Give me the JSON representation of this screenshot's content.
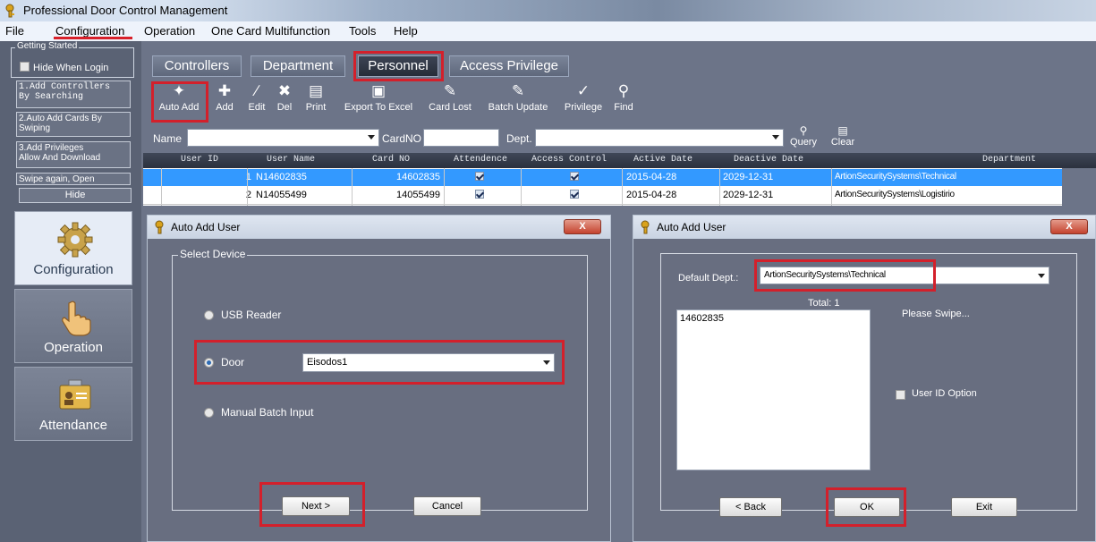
{
  "window": {
    "title": "Professional Door Control Management"
  },
  "menu": [
    "File",
    "Configuration",
    "Operation",
    "One Card Multifunction",
    "Tools",
    "Help"
  ],
  "sidebar": {
    "getting_started": "Getting Started",
    "hide_when_login": "Hide When Login",
    "steps": [
      "1.Add Controllers\nBy Searching",
      "2.Auto Add Cards By\nSwiping",
      "3.Add Privileges\nAllow And Download",
      "Swipe again, Open"
    ],
    "hide_button": "Hide",
    "nav": [
      "Configuration",
      "Operation",
      "Attendance"
    ]
  },
  "tabs": [
    "Controllers",
    "Department",
    "Personnel",
    "Access Privilege"
  ],
  "toolbar": [
    "Auto Add",
    "Add",
    "Edit",
    "Del",
    "Print",
    "Export To Excel",
    "Card Lost",
    "Batch Update",
    "Privilege",
    "Find"
  ],
  "search": {
    "name_label": "Name",
    "cardno_label": "CardNO",
    "dept_label": "Dept.",
    "query": "Query",
    "clear": "Clear"
  },
  "grid": {
    "columns": [
      "User ID",
      "User Name",
      "Card NO",
      "Attendence",
      "Access Control",
      "Active Date",
      "Deactive Date",
      "Department"
    ],
    "rows": [
      {
        "id": "1",
        "name": "N14602835",
        "card": "14602835",
        "attendance": true,
        "access": true,
        "active": "2015-04-28",
        "deactive": "2029-12-31",
        "dept": "ArtionSecuritySystems\\Technical"
      },
      {
        "id": "2",
        "name": "N14055499",
        "card": "14055499",
        "attendance": true,
        "access": true,
        "active": "2015-04-28",
        "deactive": "2029-12-31",
        "dept": "ArtionSecuritySystems\\Logistirio"
      }
    ]
  },
  "dialog1": {
    "title": "Auto Add User",
    "close": "X",
    "group": "Select Device",
    "options": [
      "USB Reader",
      "Door",
      "Manual Batch Input"
    ],
    "selected_option": "Door",
    "door_value": "Eisodos1",
    "next": "Next >",
    "cancel": "Cancel"
  },
  "dialog2": {
    "title": "Auto Add User",
    "close": "X",
    "default_dept_label": "Default Dept.:",
    "default_dept_value": "ArtionSecuritySystems\\Technical",
    "total": "Total: 1",
    "list": [
      "14602835"
    ],
    "please_swipe": "Please Swipe...",
    "user_id_option": "User ID Option",
    "back": "< Back",
    "ok": "OK",
    "exit": "Exit"
  },
  "colors": {
    "accent_red": "#d3202b",
    "selection_blue": "#3399ff",
    "panel_gray": "#6c7488"
  }
}
